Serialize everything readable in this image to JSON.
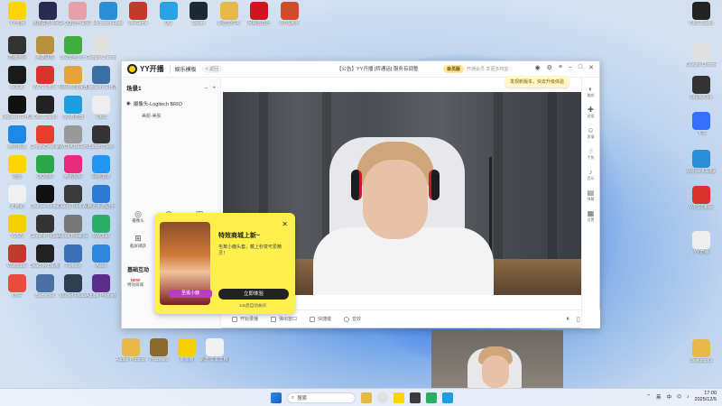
{
  "desktop": {
    "icons_left": [
      {
        "label": "YY开播",
        "color": "#ffd400"
      },
      {
        "label": "英雄联盟 WeGame",
        "color": "#2a2a50"
      },
      {
        "label": "QQ音乐 歌词",
        "color": "#e8a0a8"
      },
      {
        "label": "Microsoft Edge",
        "color": "#2b8fd6"
      },
      {
        "label": "WeGame",
        "color": "#c43a2a"
      },
      {
        "label": "QQ",
        "color": "#2aa3e6"
      },
      {
        "label": "Steam",
        "color": "#1b2838"
      },
      {
        "label": "新建文件夹",
        "color": "#e8b84a"
      },
      {
        "label": "网易云音乐",
        "color": "#d2141e"
      },
      {
        "label": "WPS演示",
        "color": "#d14b2b"
      },
      {
        "label": "直播伴侣",
        "color": "#333"
      },
      {
        "label": "英雄联盟",
        "color": "#b8913c"
      },
      {
        "label": "360安全卫士",
        "color": "#3fae3f"
      },
      {
        "label": "Google Chrome",
        "color": "#e0e0e0"
      },
      {
        "label": "KOOK",
        "color": "#1a1a1a"
      },
      {
        "label": "WPS Office",
        "color": "#d9342b"
      },
      {
        "label": "网易UU加速器",
        "color": "#e6a23c"
      },
      {
        "label": "Logitech G HUB",
        "color": "#3a6ea5"
      },
      {
        "label": "Logitech G HUB",
        "color": "#111"
      },
      {
        "label": "OBS Studio",
        "color": "#222"
      },
      {
        "label": "QQ浏览器",
        "color": "#1aa0e0"
      },
      {
        "label": "OBS",
        "color": "#eee"
      },
      {
        "label": "腾讯会议",
        "color": "#1e88e5"
      },
      {
        "label": "GoogleDownload",
        "color": "#e63e2a"
      },
      {
        "label": "NVIDIA GeForce",
        "color": "#999"
      },
      {
        "label": "Steam Deck",
        "color": "#333"
      },
      {
        "label": "迅雷",
        "color": "#ffd400"
      },
      {
        "label": "QQ游戏",
        "color": "#2ba84a"
      },
      {
        "label": "腾讯视频",
        "color": "#e9297c"
      },
      {
        "label": "网络加速",
        "color": "#2196f3"
      },
      {
        "label": "此电脑",
        "color": "#f0f0f0"
      },
      {
        "label": "Counter-Strike 2",
        "color": "#111"
      },
      {
        "label": "Grand Theft Auto",
        "color": "#3a3a3a"
      },
      {
        "label": "腾讯手游助手",
        "color": "#2b7bd6"
      },
      {
        "label": "VVEN",
        "color": "#f5d000"
      },
      {
        "label": "Genshin Impact",
        "color": "#333"
      },
      {
        "label": "Arena Breakout",
        "color": "#777"
      },
      {
        "label": "WeChat",
        "color": "#2aae67"
      },
      {
        "label": "Wallpaper",
        "color": "#c0392b"
      },
      {
        "label": "Dead by Daylight",
        "color": "#222"
      },
      {
        "label": "Fortnite",
        "color": "#3b6fb6"
      },
      {
        "label": "Apex",
        "color": "#2e86de"
      },
      {
        "label": "DNF",
        "color": "#e74c3c"
      },
      {
        "label": "Battle.net",
        "color": "#4a6fa5"
      },
      {
        "label": "Marvel Rivals",
        "color": "#2c3e50"
      },
      {
        "label": "Adobe Premiere",
        "color": "#5b2d8a"
      }
    ],
    "icons_bottom": [
      {
        "label": "Adobe Photoshop",
        "color": "#e8b84a"
      },
      {
        "label": "Prisoners",
        "color": "#8a6a2a"
      },
      {
        "label": "新加坡",
        "color": "#f5d000"
      },
      {
        "label": "新建 文本文档 (2).txt",
        "color": "#f0f0f0"
      }
    ],
    "icons_right": [
      {
        "label": "OBS Studio",
        "color": "#222"
      },
      {
        "label": "Google Chrome",
        "color": "#e0e0e0"
      },
      {
        "label": "Studio One",
        "color": "#333"
      },
      {
        "label": "飞书",
        "color": "#3370ff"
      },
      {
        "label": "Microsoft Edge",
        "color": "#2b8fd6"
      },
      {
        "label": "WPS Office",
        "color": "#d9342b"
      },
      {
        "label": "YY直播",
        "color": "#eee"
      },
      {
        "label": "desktop.ini",
        "color": "#e8b84a"
      }
    ]
  },
  "app": {
    "logo": "YY开播",
    "mode": "娱乐模板",
    "beta": "< 返回",
    "announcement": "【公告】YY开播 [转通话] 服务有调整",
    "vip_badge": "会员版",
    "vip_info": "开通会员 享更多权益",
    "tip": "发现新版本，快去升级体验",
    "scene_title": "场景1",
    "source_camera": "摄像头-Logitech BRIO",
    "source_sub": "美颜-美肤",
    "tools": [
      {
        "icon": "◎",
        "label": "摄像头"
      },
      {
        "icon": "◷",
        "label": "桌面"
      },
      {
        "icon": "◫",
        "label": "图片"
      },
      {
        "icon": "⊡",
        "label": "窗口"
      }
    ],
    "tool_capture": {
      "icon": "⊞",
      "label": "截屏捕获"
    },
    "section_title": "基础互动",
    "special_label": "特效商城",
    "special_badge": "NEW",
    "bottom": {
      "start": "开始录播",
      "float": "弹出窗口",
      "fast": "快捷键",
      "audio": "音效"
    },
    "right_tools": [
      {
        "icon": "◐",
        "label": "美颜"
      },
      {
        "icon": "✚",
        "label": "滤镜"
      },
      {
        "icon": "☺",
        "label": "表情"
      },
      {
        "icon": "☝",
        "label": "手势"
      },
      {
        "icon": "♪",
        "label": "音乐"
      },
      {
        "icon": "▤",
        "label": "弹幕"
      },
      {
        "icon": "▦",
        "label": "设置"
      }
    ]
  },
  "promo": {
    "title": "特效商城上新~",
    "desc": "毛茸小鹿头套，戴上秒变可爱精灵！",
    "button": "立即体验",
    "link": "14s后自动关闭",
    "close": "✕",
    "image_caption": "圣诞小鹿"
  },
  "taskbar": {
    "search_placeholder": "搜索",
    "lang": "中",
    "ime": "英",
    "time": "17:00",
    "date": "2025/12/5"
  }
}
